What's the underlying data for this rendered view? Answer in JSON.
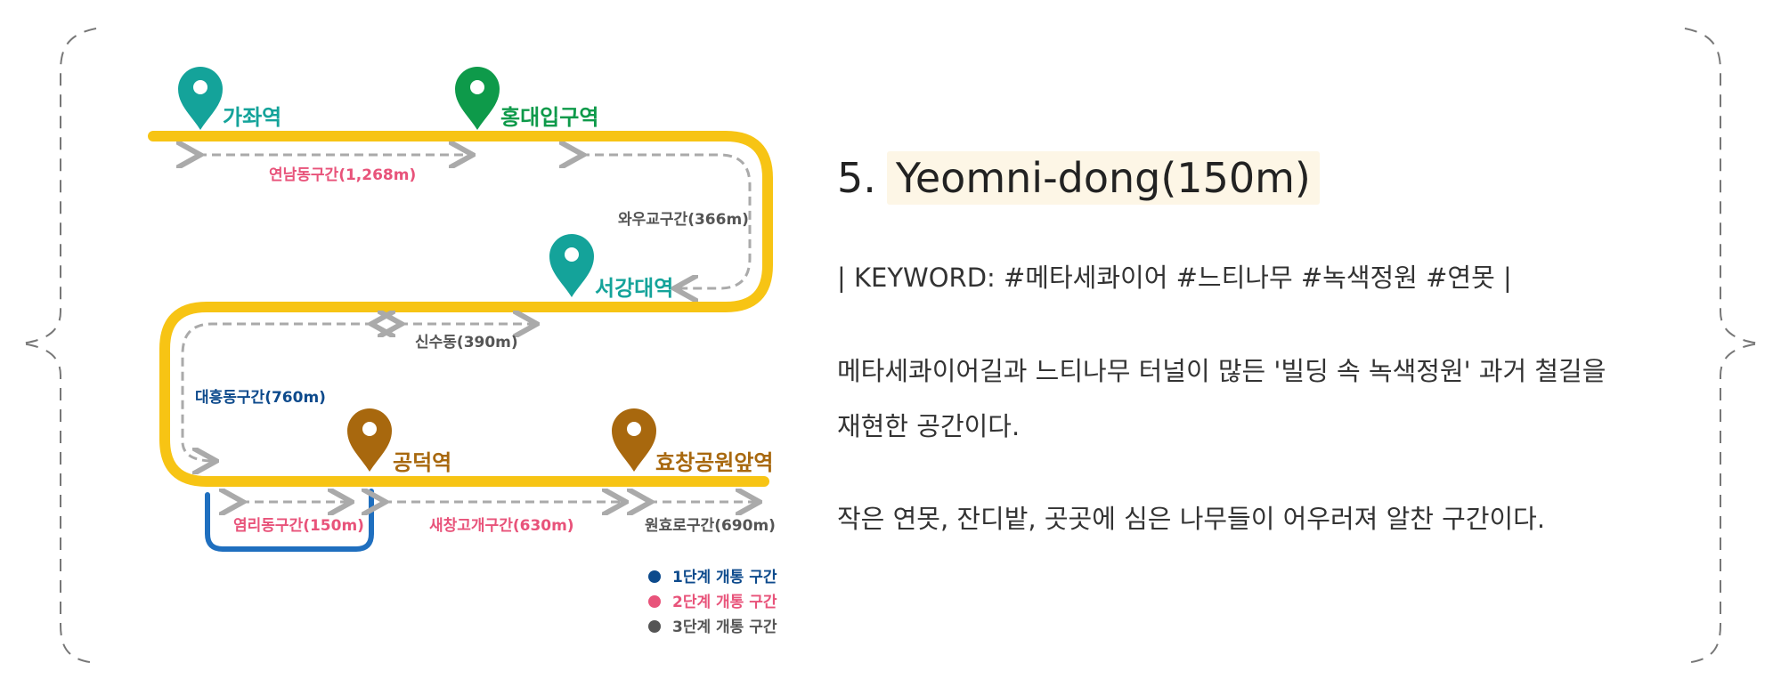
{
  "map": {
    "stations": {
      "gajwa": "가좌역",
      "hongik": "홍대입구역",
      "sogang": "서강대역",
      "gongdeok": "공덕역",
      "hyochang": "효창공원앞역"
    },
    "sections": {
      "yeonnam": "연남동구간(1,268m)",
      "wawoo": "와우교구간(366m)",
      "sinsu": "신수동(390m)",
      "daeheung": "대흥동구간(760m)",
      "yeomni": "염리동구간(150m)",
      "saechang": "새창고개구간(630m)",
      "wonhyo": "원효로구간(690m)"
    },
    "legend": [
      {
        "label": "1단계 개통 구간",
        "color": "#0d4a8c"
      },
      {
        "label": "2단계 개통 구간",
        "color": "#e8537a"
      },
      {
        "label": "3단계 개통 구간",
        "color": "#555555"
      }
    ],
    "colors": {
      "track": "#f7c414",
      "teal_pin": "#14a39a",
      "green_pin": "#0e9a4a",
      "brown_pin": "#a8680e",
      "stage1": "#0d4a8c",
      "stage2": "#e8537a",
      "stage3": "#555555",
      "highlight": "#1f6fbf"
    }
  },
  "content": {
    "number": "5.",
    "title": "Yeomni-dong(150m)",
    "keywords": "| KEYWORD: #메타세콰이어 #느티나무 #녹색정원 #연못 |",
    "paragraph1_line1": "메타세콰이어길과 느티나무 터널이 많든 '빌딩 속 녹색정원' 과거 철길을",
    "paragraph1_line2": "재현한 공간이다.",
    "paragraph2": "작은 연못, 잔디밭, 곳곳에 심은 나무들이 어우러져 알찬 구간이다."
  }
}
